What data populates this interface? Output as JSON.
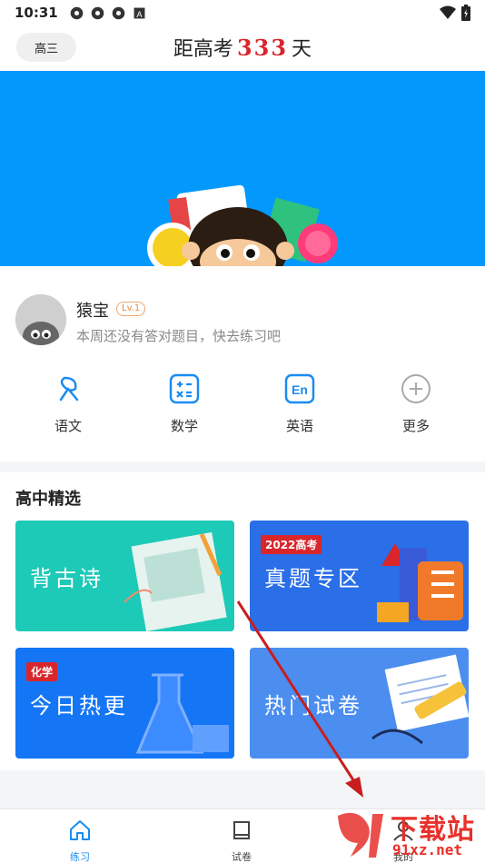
{
  "status_bar": {
    "time": "10:31",
    "icons": [
      "app-notification-icon",
      "app-notification-icon",
      "app-notification-icon",
      "a-box-icon"
    ],
    "right_icons": [
      "wifi-icon",
      "battery-icon"
    ]
  },
  "header": {
    "grade": "高三",
    "countdown_prefix": "距高考",
    "countdown_days": "333",
    "countdown_suffix": "天"
  },
  "profile": {
    "name": "猿宝",
    "level": "Lv.1",
    "hint": "本周还没有答对题目，快去练习吧"
  },
  "subjects": [
    {
      "label": "语文",
      "icon": "chinese-brush-icon"
    },
    {
      "label": "数学",
      "icon": "calculator-icon"
    },
    {
      "label": "英语",
      "icon": "english-en-icon"
    },
    {
      "label": "更多",
      "icon": "plus-circle-icon"
    }
  ],
  "section": {
    "title": "高中精选",
    "cards": [
      {
        "title": "背古诗",
        "tag": "",
        "color": "#1dc9b7"
      },
      {
        "title": "真题专区",
        "tag": "2022高考",
        "color": "#2a6ee8"
      },
      {
        "title": "今日热更",
        "tag": "化学",
        "color": "#1476f5"
      },
      {
        "title": "热门试卷",
        "tag": "",
        "color": "#4b8ef0"
      }
    ]
  },
  "tabs": [
    {
      "label": "练习",
      "icon": "home-icon",
      "active": true
    },
    {
      "label": "试卷",
      "icon": "paper-icon",
      "active": false
    },
    {
      "label": "我的",
      "icon": "user-icon",
      "active": false
    }
  ],
  "watermark": {
    "text": "下载站",
    "url_text": "91xz.net"
  },
  "colors": {
    "accent": "#1a8cf0",
    "banner": "#0399fc",
    "countdown_red": "#d9262b"
  }
}
